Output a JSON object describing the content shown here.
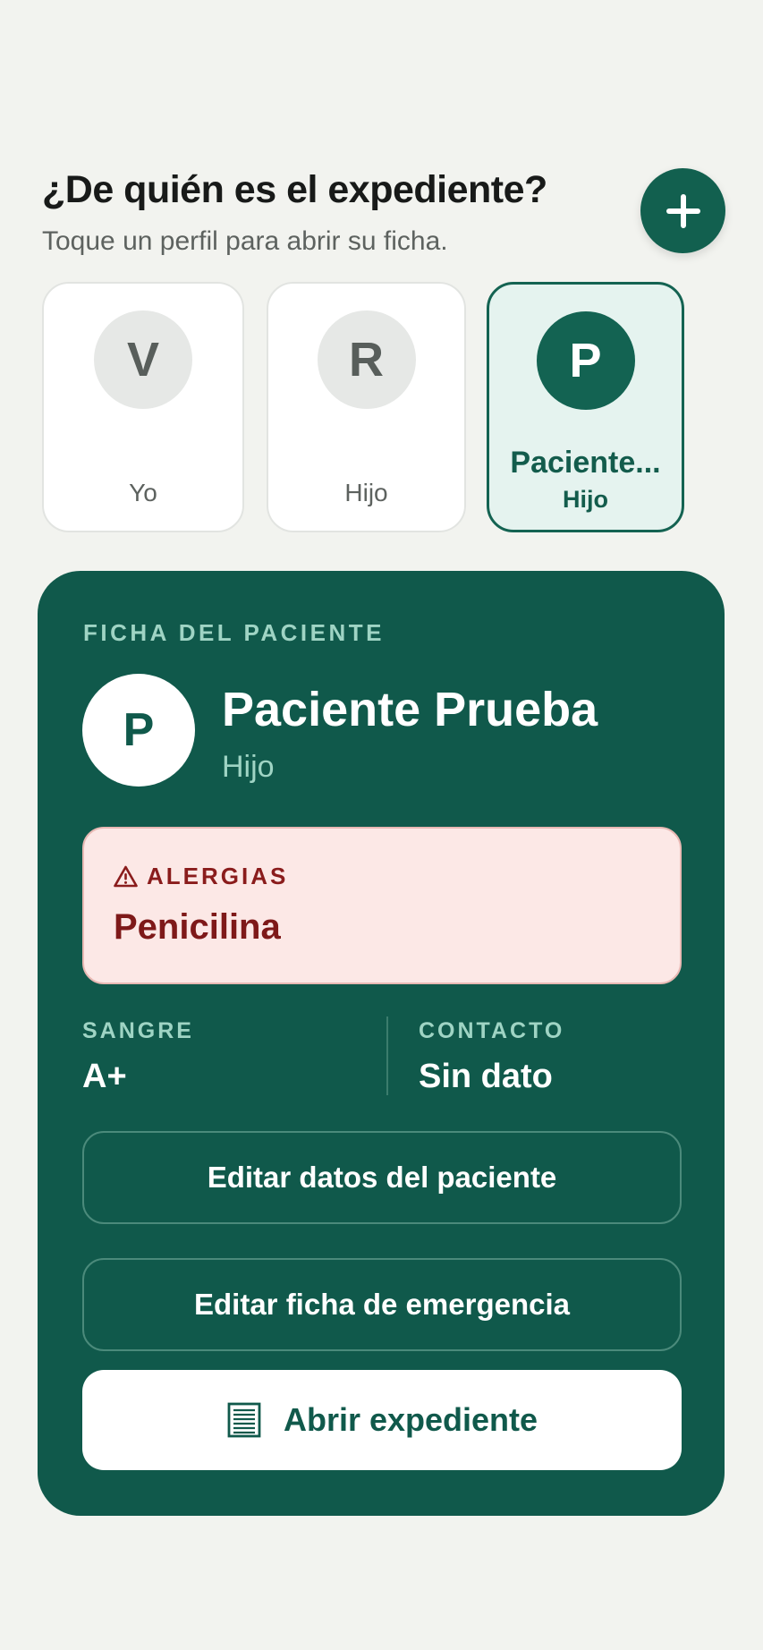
{
  "header": {
    "title": "¿De quién es el expediente?",
    "subtitle": "Toque un perfil para abrir su ficha."
  },
  "add_button": {
    "icon": "plus-icon"
  },
  "profiles": [
    {
      "initial": "V",
      "name": "",
      "relation": "Yo",
      "selected": false
    },
    {
      "initial": "R",
      "name": "",
      "relation": "Hijo",
      "selected": false
    },
    {
      "initial": "P",
      "name": "Paciente...",
      "relation": "Hijo",
      "selected": true
    }
  ],
  "sheet": {
    "label": "FICHA DEL PACIENTE",
    "initial": "P",
    "name": "Paciente Prueba",
    "relation": "Hijo",
    "allergies": {
      "icon": "warning-icon",
      "label": "ALERGIAS",
      "value": "Penicilina"
    },
    "blood": {
      "label": "SANGRE",
      "value": "A+"
    },
    "contact": {
      "label": "CONTACTO",
      "value": "Sin dato"
    },
    "buttons": {
      "edit_patient": "Editar datos del paciente",
      "edit_emergency": "Editar ficha de emergencia",
      "open_record": "Abrir expediente",
      "open_record_icon": "document-icon"
    }
  },
  "colors": {
    "brand_green": "#10594b",
    "accent_mint": "#9fd4c4",
    "allergy_bg": "#fce8e6",
    "allergy_text": "#8a1c1c",
    "background": "#f2f3ef"
  }
}
